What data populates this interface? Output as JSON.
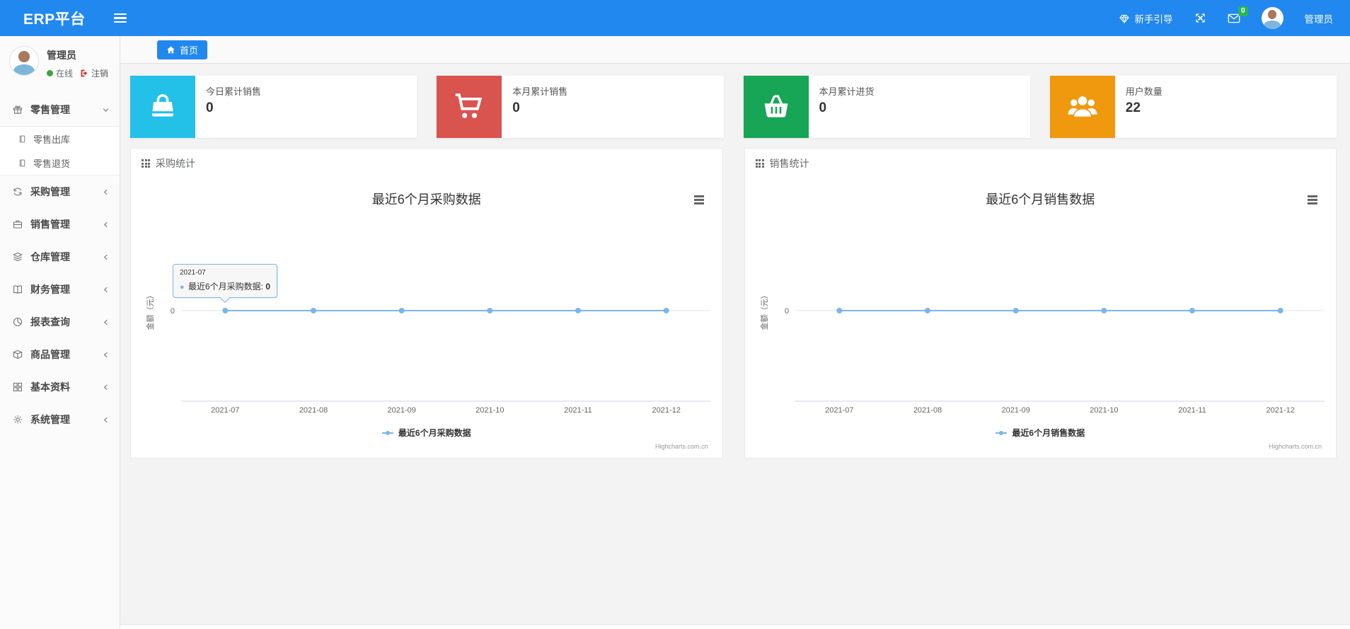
{
  "topbar": {
    "brand": "ERP平台",
    "guide_label": "新手引导",
    "mail_badge": "0",
    "user_name": "管理员"
  },
  "tabs": [
    {
      "label": "首页",
      "active": true
    }
  ],
  "sidebar": {
    "user": {
      "name": "管理员",
      "status": "在线",
      "logout": "注销"
    },
    "menu": [
      {
        "label": "零售管理",
        "icon": "gift-icon",
        "expanded": true,
        "children": [
          {
            "label": "零售出库",
            "icon": "document-icon"
          },
          {
            "label": "零售退货",
            "icon": "document-icon"
          }
        ]
      },
      {
        "label": "采购管理",
        "icon": "exchange-icon"
      },
      {
        "label": "销售管理",
        "icon": "briefcase-icon"
      },
      {
        "label": "仓库管理",
        "icon": "layers-icon"
      },
      {
        "label": "财务管理",
        "icon": "book-icon"
      },
      {
        "label": "报表查询",
        "icon": "pie-chart-icon"
      },
      {
        "label": "商品管理",
        "icon": "box-icon"
      },
      {
        "label": "基本资料",
        "icon": "grid-icon"
      },
      {
        "label": "系统管理",
        "icon": "gear-icon"
      }
    ]
  },
  "stat_cards": [
    {
      "label": "今日累计销售",
      "value": "0",
      "color": "#23c0e8",
      "icon": "shopping-bag-icon"
    },
    {
      "label": "本月累计销售",
      "value": "0",
      "color": "#d9534f",
      "icon": "shopping-cart-icon"
    },
    {
      "label": "本月累计进货",
      "value": "0",
      "color": "#17a556",
      "icon": "basket-icon"
    },
    {
      "label": "用户数量",
      "value": "22",
      "color": "#f0980e",
      "icon": "users-icon"
    }
  ],
  "panels": [
    {
      "title": "采购统计"
    },
    {
      "title": "销售统计"
    }
  ],
  "chart_data": [
    {
      "type": "line",
      "title": "最近6个月采购数据",
      "categories": [
        "2021-07",
        "2021-08",
        "2021-09",
        "2021-10",
        "2021-11",
        "2021-12"
      ],
      "series": [
        {
          "name": "最近6个月采购数据",
          "values": [
            0,
            0,
            0,
            0,
            0,
            0
          ],
          "color": "#7cb5ec"
        }
      ],
      "xlabel": "",
      "ylabel": "金额（元）",
      "yticks": [
        "0"
      ],
      "ylim": [
        0,
        0
      ],
      "grid": true,
      "legend_position": "bottom",
      "credit": "Highcharts.com.cn",
      "tooltip": {
        "header": "2021-07",
        "point_index": 0,
        "series_label": "最近6个月采购数据:",
        "value": "0"
      }
    },
    {
      "type": "line",
      "title": "最近6个月销售数据",
      "categories": [
        "2021-07",
        "2021-08",
        "2021-09",
        "2021-10",
        "2021-11",
        "2021-12"
      ],
      "series": [
        {
          "name": "最近6个月销售数据",
          "values": [
            0,
            0,
            0,
            0,
            0,
            0
          ],
          "color": "#7cb5ec"
        }
      ],
      "xlabel": "",
      "ylabel": "金额（元）",
      "yticks": [
        "0"
      ],
      "ylim": [
        0,
        0
      ],
      "grid": true,
      "legend_position": "bottom",
      "credit": "Highcharts.com.cn"
    }
  ],
  "colors": {
    "accent": "#2188f0",
    "series": "#7cb5ec",
    "badge_green": "#2ab55c",
    "online_green": "#3fa33f",
    "logout_red": "#c9302c"
  }
}
